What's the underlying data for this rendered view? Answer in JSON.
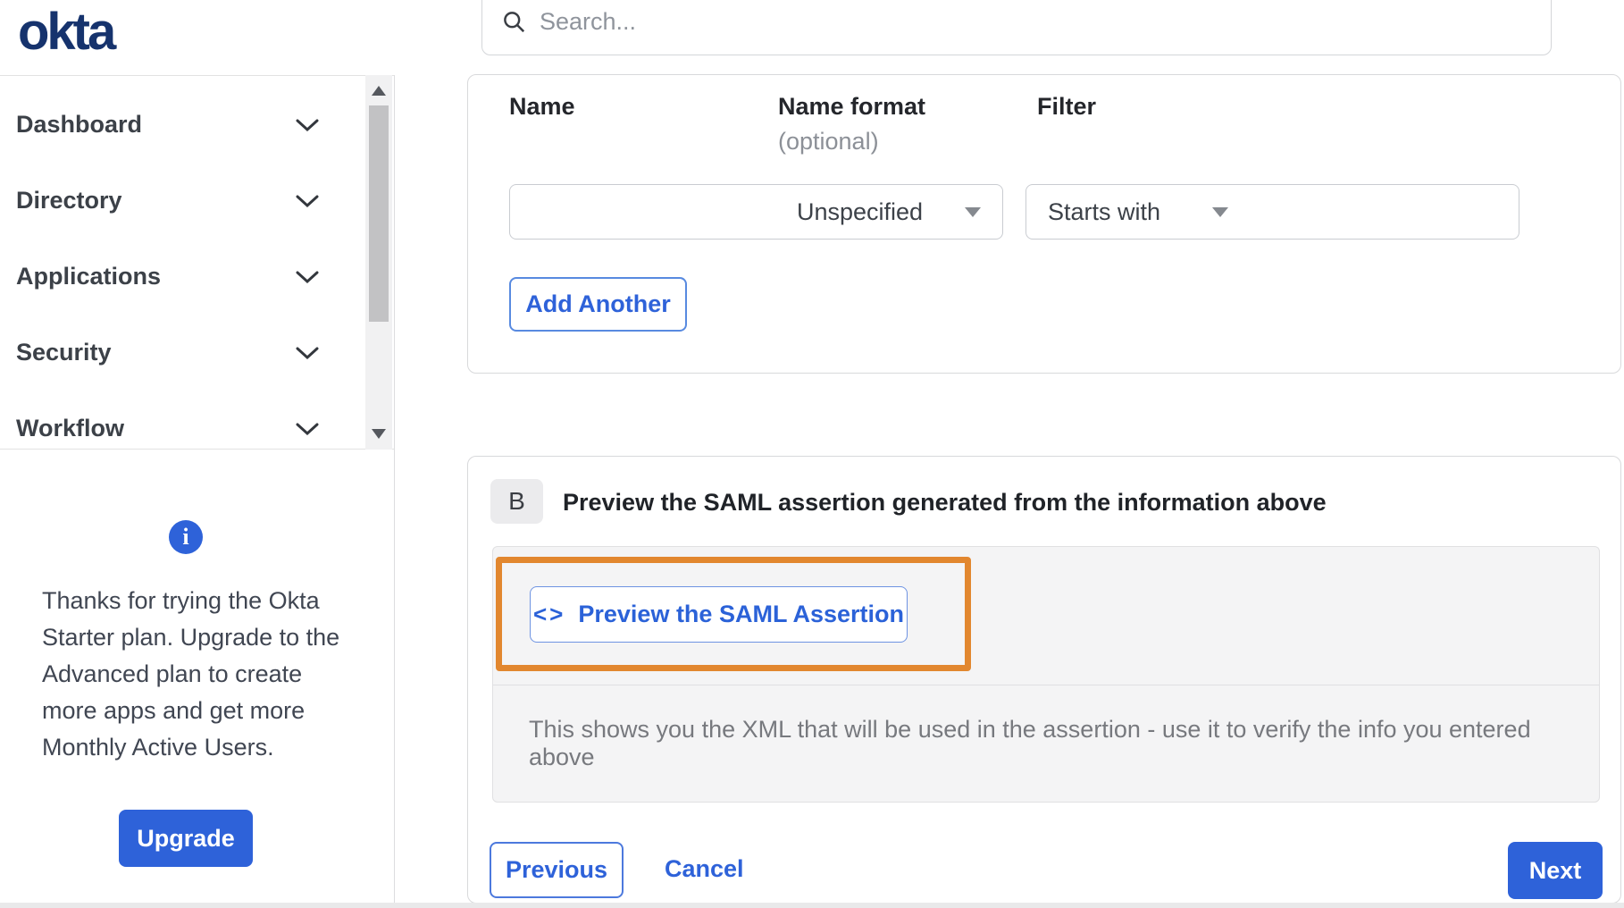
{
  "brand": {
    "logo_text": "okta",
    "logo_color": "#16336d"
  },
  "search": {
    "placeholder": "Search...",
    "icon": "magnifier-icon"
  },
  "sidebar": {
    "items": [
      {
        "label": "Dashboard"
      },
      {
        "label": "Directory"
      },
      {
        "label": "Applications"
      },
      {
        "label": "Security"
      },
      {
        "label": "Workflow"
      }
    ],
    "upsell": {
      "icon": "info-icon",
      "message": "Thanks for trying the Okta Starter plan. Upgrade to the Advanced plan to create more apps and get more Monthly Active Users.",
      "upgrade_label": "Upgrade"
    }
  },
  "attribute_form": {
    "columns": [
      {
        "label": "Name"
      },
      {
        "label": "Name format",
        "hint": "(optional)"
      },
      {
        "label": "Filter"
      }
    ],
    "row": {
      "name_value": "",
      "name_format_selected": "Unspecified",
      "filter_type_selected": "Starts with",
      "filter_value": ""
    },
    "add_another_label": "Add Another"
  },
  "preview_section": {
    "step_badge": "B",
    "heading": "Preview the SAML assertion generated from the information above",
    "preview_button_icon": "<>",
    "preview_button_label": "Preview the SAML Assertion",
    "description": "This shows you the XML that will be used in the assertion - use it to verify the info you entered above"
  },
  "wizard_footer": {
    "previous_label": "Previous",
    "cancel_label": "Cancel",
    "next_label": "Next"
  },
  "colors": {
    "primary_blue": "#2e62d9",
    "logo_navy": "#16336d",
    "highlight_orange": "#e2872f",
    "panel_gray": "#f4f4f5"
  }
}
